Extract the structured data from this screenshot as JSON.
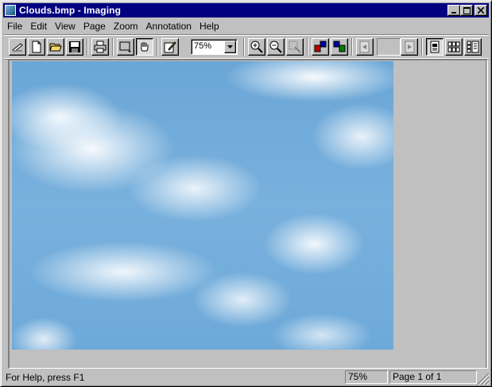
{
  "window": {
    "title": "Clouds.bmp - Imaging",
    "minimize_label": "_",
    "maximize_label": "□",
    "close_label": "×"
  },
  "menu": {
    "items": [
      {
        "label": "File"
      },
      {
        "label": "Edit"
      },
      {
        "label": "View"
      },
      {
        "label": "Page"
      },
      {
        "label": "Zoom"
      },
      {
        "label": "Annotation"
      },
      {
        "label": "Help"
      }
    ]
  },
  "toolbar": {
    "buttons": [
      {
        "name": "scan-icon"
      },
      {
        "name": "new-icon"
      },
      {
        "name": "open-icon"
      },
      {
        "name": "save-icon"
      },
      {
        "name": "print-icon"
      },
      {
        "name": "select-rectangle-icon"
      },
      {
        "name": "hand-drag-icon"
      },
      {
        "name": "annotation-toolbar-icon"
      },
      {
        "name": "zoom-in-icon"
      },
      {
        "name": "zoom-out-icon"
      },
      {
        "name": "zoom-to-selection-icon"
      },
      {
        "name": "rotate-left-icon"
      },
      {
        "name": "rotate-right-icon"
      },
      {
        "name": "previous-page-icon"
      },
      {
        "name": "next-page-icon"
      },
      {
        "name": "one-page-view-icon"
      },
      {
        "name": "thumbnail-view-icon"
      },
      {
        "name": "page-and-thumbnails-view-icon"
      }
    ],
    "zoom_value": "75%",
    "page_field_value": ""
  },
  "document": {
    "file": "Clouds.bmp",
    "image_description": "sky with clouds"
  },
  "status": {
    "help_text": "For Help, press F1",
    "zoom": "75%",
    "page": "Page 1 of 1"
  },
  "colors": {
    "title_bar": "#000080",
    "face": "#c0c0c0",
    "sky": "#6aa6d6"
  }
}
